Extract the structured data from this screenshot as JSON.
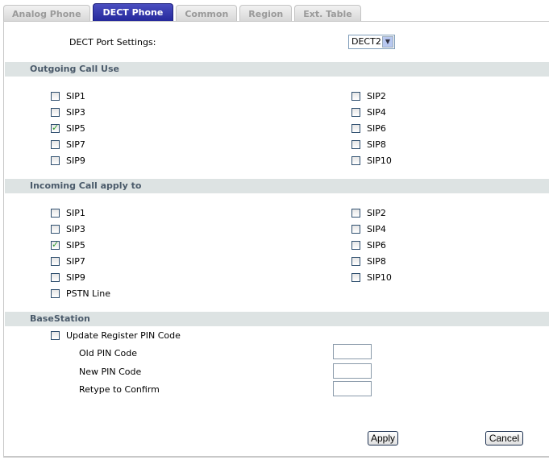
{
  "tabs": [
    {
      "label": "Analog Phone",
      "active": false
    },
    {
      "label": "DECT Phone",
      "active": true
    },
    {
      "label": "Common",
      "active": false
    },
    {
      "label": "Region",
      "active": false
    },
    {
      "label": "Ext. Table",
      "active": false
    }
  ],
  "port": {
    "label": "DECT Port Settings:",
    "value": "DECT2"
  },
  "outgoing": {
    "title": "Outgoing Call Use",
    "items": [
      {
        "label": "SIP1",
        "checked": false
      },
      {
        "label": "SIP2",
        "checked": false
      },
      {
        "label": "SIP3",
        "checked": false
      },
      {
        "label": "SIP4",
        "checked": false
      },
      {
        "label": "SIP5",
        "checked": true
      },
      {
        "label": "SIP6",
        "checked": false
      },
      {
        "label": "SIP7",
        "checked": false
      },
      {
        "label": "SIP8",
        "checked": false
      },
      {
        "label": "SIP9",
        "checked": false
      },
      {
        "label": "SIP10",
        "checked": false
      }
    ]
  },
  "incoming": {
    "title": "Incoming Call apply to",
    "items": [
      {
        "label": "SIP1",
        "checked": false
      },
      {
        "label": "SIP2",
        "checked": false
      },
      {
        "label": "SIP3",
        "checked": false
      },
      {
        "label": "SIP4",
        "checked": false
      },
      {
        "label": "SIP5",
        "checked": true
      },
      {
        "label": "SIP6",
        "checked": false
      },
      {
        "label": "SIP7",
        "checked": false
      },
      {
        "label": "SIP8",
        "checked": false
      },
      {
        "label": "SIP9",
        "checked": false
      },
      {
        "label": "SIP10",
        "checked": false
      },
      {
        "label": "PSTN Line",
        "checked": false
      }
    ]
  },
  "base": {
    "title": "BaseStation",
    "update_label": "Update Register PIN Code",
    "update_checked": false,
    "old_pin": "Old PIN Code",
    "new_pin": "New PIN Code",
    "retype": "Retype to Confirm"
  },
  "buttons": {
    "apply": "Apply",
    "cancel": "Cancel"
  }
}
